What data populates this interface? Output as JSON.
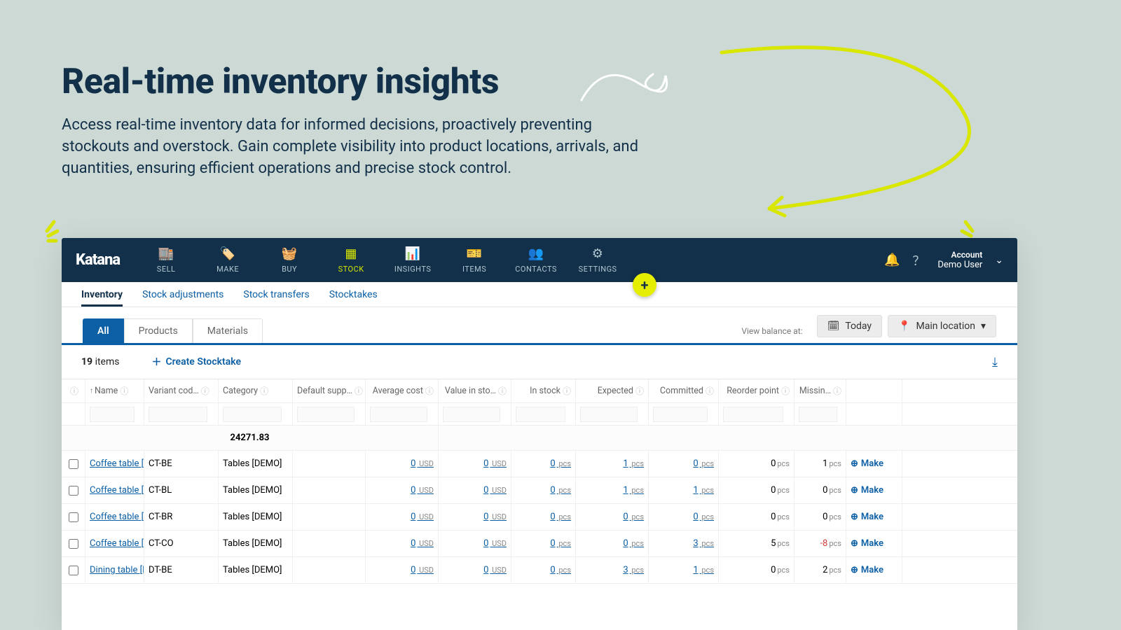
{
  "hero": {
    "title": "Real-time inventory insights",
    "body": "Access real-time inventory data for informed decisions, proactively preventing stockouts and overstock. Gain complete visibility into product locations, arrivals, and quantities, ensuring efficient operations and precise stock control."
  },
  "colors": {
    "accent": "#d8e600",
    "primary": "#0b5fa5",
    "dark": "#123049"
  },
  "brand": "Katana",
  "nav": {
    "items": [
      {
        "label": "SELL"
      },
      {
        "label": "MAKE"
      },
      {
        "label": "BUY"
      },
      {
        "label": "STOCK"
      },
      {
        "label": "INSIGHTS"
      },
      {
        "label": "ITEMS"
      },
      {
        "label": "CONTACTS"
      },
      {
        "label": "SETTINGS"
      }
    ],
    "active": 3,
    "account_label": "Account",
    "account_user": "Demo User"
  },
  "subtabs": {
    "items": [
      "Inventory",
      "Stock adjustments",
      "Stock transfers",
      "Stocktakes"
    ],
    "active": 0
  },
  "pills": {
    "items": [
      "All",
      "Products",
      "Materials"
    ],
    "active": 0
  },
  "balance_label": "View balance at:",
  "today_btn": "Today",
  "location_btn": "Main location",
  "item_count": "19",
  "item_unit": "items",
  "create_label": "Create Stocktake",
  "columns": [
    "Name",
    "Variant cod…",
    "Category",
    "Default supp…",
    "Average cost",
    "Value in sto…",
    "In stock",
    "Expected",
    "Committed",
    "Reorder point",
    "Missin…"
  ],
  "total_value": "24271.83",
  "currency_unit": "USD",
  "qty_unit": "pcs",
  "make_label": "Make",
  "rows": [
    {
      "name": "Coffee table [D",
      "variant": "CT-BE",
      "category": "Tables [DEMO]",
      "avg_cost": "0",
      "value": "0",
      "in_stock": "0",
      "expected": "1",
      "committed": "0",
      "reorder": "0",
      "missing": "1"
    },
    {
      "name": "Coffee table [D",
      "variant": "CT-BL",
      "category": "Tables [DEMO]",
      "avg_cost": "0",
      "value": "0",
      "in_stock": "0",
      "expected": "1",
      "committed": "1",
      "reorder": "0",
      "missing": "0"
    },
    {
      "name": "Coffee table [D",
      "variant": "CT-BR",
      "category": "Tables [DEMO]",
      "avg_cost": "0",
      "value": "0",
      "in_stock": "0",
      "expected": "0",
      "committed": "0",
      "reorder": "0",
      "missing": "0"
    },
    {
      "name": "Coffee table [D",
      "variant": "CT-CO",
      "category": "Tables [DEMO]",
      "avg_cost": "0",
      "value": "0",
      "in_stock": "0",
      "expected": "0",
      "committed": "3",
      "reorder": "5",
      "missing": "-8"
    },
    {
      "name": "Dining table [D",
      "variant": "DT-BE",
      "category": "Tables [DEMO]",
      "avg_cost": "0",
      "value": "0",
      "in_stock": "0",
      "expected": "3",
      "committed": "1",
      "reorder": "0",
      "missing": "2"
    }
  ]
}
